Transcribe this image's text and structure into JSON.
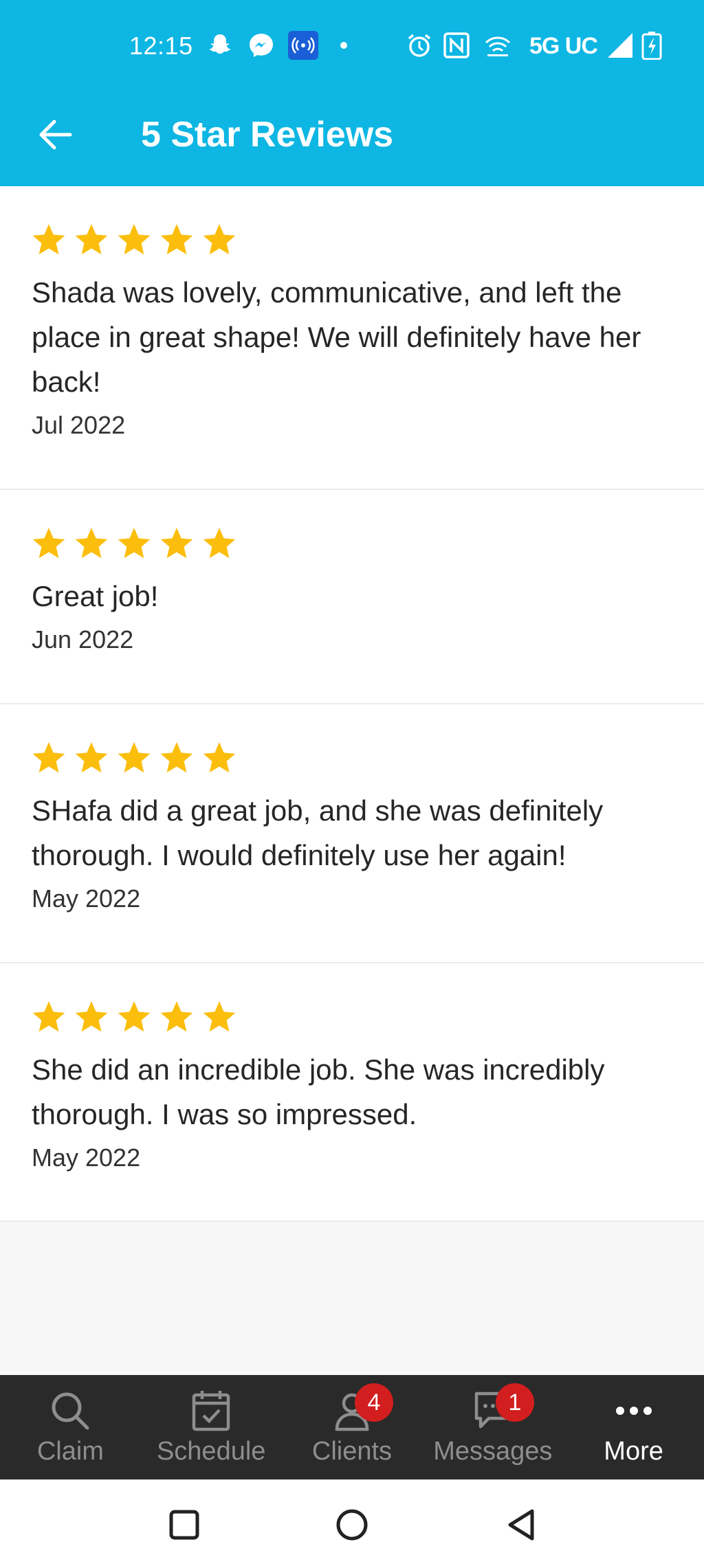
{
  "status_bar": {
    "time": "12:15",
    "network": "5G UC",
    "icons": [
      "snapchat-icon",
      "messenger-icon",
      "hotspot-icon",
      "dot-icon",
      "alarm-icon",
      "nfc-icon",
      "wifi-calling-icon",
      "signal-icon",
      "battery-icon"
    ]
  },
  "app_bar": {
    "title": "5 Star Reviews",
    "back_icon": "back-arrow-icon"
  },
  "colors": {
    "app_bar": "#0db6e3",
    "star": "#fbbe0c",
    "badge": "#d21e1e",
    "bottom_nav": "#2a2a2a"
  },
  "reviews": [
    {
      "rating": 5,
      "text": "Shada was lovely, communicative, and left the place in great shape! We will definitely have her back!",
      "date": "Jul 2022"
    },
    {
      "rating": 5,
      "text": "Great job!",
      "date": "Jun 2022"
    },
    {
      "rating": 5,
      "text": "SHafa did a great job, and she was definitely thorough.  I would definitely use her again!",
      "date": "May 2022"
    },
    {
      "rating": 5,
      "text": "She did an incredible job. She was incredibly thorough. I was so impressed.",
      "date": "May 2022"
    }
  ],
  "bottom_nav": {
    "items": [
      {
        "label": "Claim",
        "icon": "search-icon",
        "badge": ""
      },
      {
        "label": "Schedule",
        "icon": "calendar-check-icon",
        "badge": ""
      },
      {
        "label": "Clients",
        "icon": "person-icon",
        "badge": "4"
      },
      {
        "label": "Messages",
        "icon": "chat-icon",
        "badge": "1"
      },
      {
        "label": "More",
        "icon": "more-dots-icon",
        "badge": "",
        "active": true
      }
    ]
  },
  "system_nav": {
    "buttons": [
      "recents-icon",
      "home-icon",
      "back-triangle-icon"
    ]
  }
}
